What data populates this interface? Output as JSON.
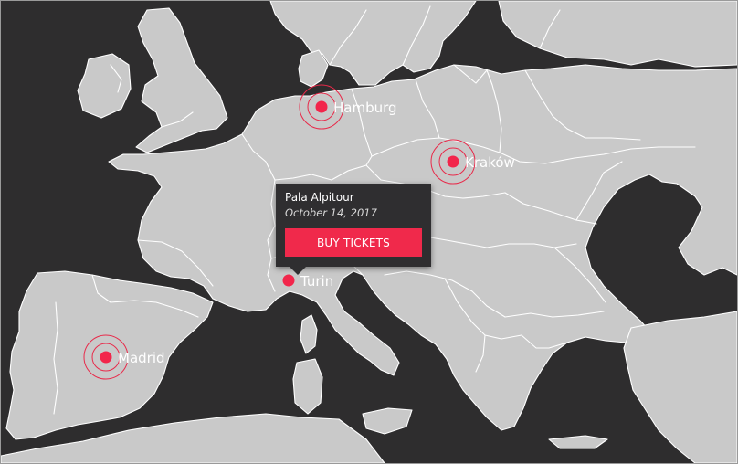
{
  "map": {
    "land_color": "#c9c9c9",
    "sea_color": "#2e2d2e",
    "border_color": "#ffffff",
    "accent_color": "#f2264b"
  },
  "markers": [
    {
      "city": "Hamburg"
    },
    {
      "city": "Kraków"
    },
    {
      "city": "Turin"
    },
    {
      "city": "Madrid"
    }
  ],
  "popup": {
    "venue": "Pala Alpitour",
    "date": "October 14, 2017",
    "button_label": "BUY TICKETS"
  }
}
